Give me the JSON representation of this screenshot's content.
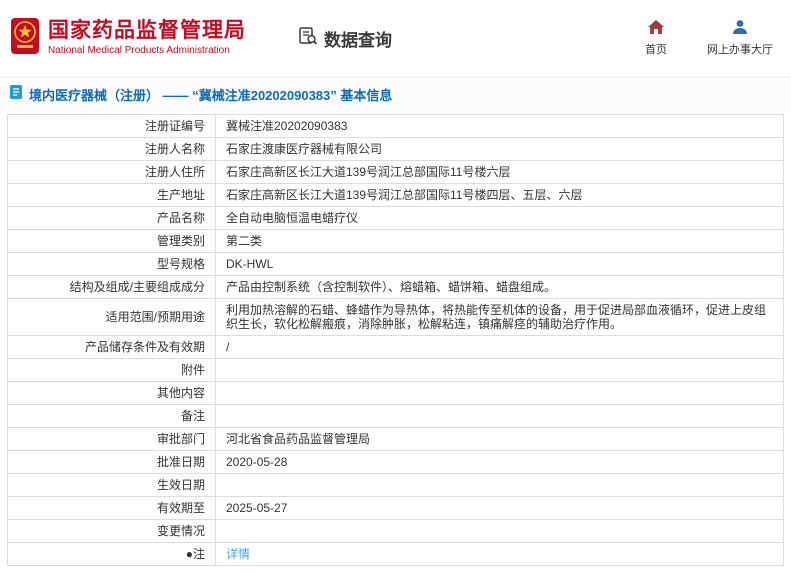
{
  "header": {
    "org_name_cn": "国家药品监督管理局",
    "org_name_en": "National Medical Products Administration",
    "section_title": "数据查询",
    "nav": [
      {
        "label": "首页"
      },
      {
        "label": "网上办事大厅"
      }
    ]
  },
  "breadcrumb": {
    "title": "境内医疗器械（注册） —— “冀械注准20202090383” 基本信息"
  },
  "table": {
    "rows": [
      {
        "label": "注册证编号",
        "value": "冀械注准20202090383"
      },
      {
        "label": "注册人名称",
        "value": "石家庄渡康医疗器械有限公司"
      },
      {
        "label": "注册人住所",
        "value": "石家庄高新区长江大道139号润江总部国际11号楼六层"
      },
      {
        "label": "生产地址",
        "value": "石家庄高新区长江大道139号润江总部国际11号楼四层、五层、六层"
      },
      {
        "label": "产品名称",
        "value": "全自动电脑恒温电蜡疗仪"
      },
      {
        "label": "管理类别",
        "value": "第二类"
      },
      {
        "label": "型号规格",
        "value": "DK-HWL"
      },
      {
        "label": "结构及组成/主要组成成分",
        "value": "产品由控制系统（含控制软件）、熔蜡箱、蜡饼箱、蜡盘组成。"
      },
      {
        "label": "适用范围/预期用途",
        "value": "利用加热溶解的石蜡、蜂蜡作为导热体，将热能传至机体的设备，用于促进局部血液循环，促进上皮组织生长，软化松解瘢痕，消除肿胀，松解粘连，镇痛解痉的辅助治疗作用。"
      },
      {
        "label": "产品储存条件及有效期",
        "value": "/"
      },
      {
        "label": "附件",
        "value": ""
      },
      {
        "label": "其他内容",
        "value": ""
      },
      {
        "label": "备注",
        "value": ""
      },
      {
        "label": "审批部门",
        "value": "河北省食品药品监督管理局"
      },
      {
        "label": "批准日期",
        "value": "2020-05-28"
      },
      {
        "label": "生效日期",
        "value": ""
      },
      {
        "label": "有效期至",
        "value": "2025-05-27"
      },
      {
        "label": "变更情况",
        "value": ""
      },
      {
        "label": "●注",
        "value": "详情",
        "link": true
      }
    ]
  },
  "icons": {
    "logo": "national-emblem",
    "query": "document-search",
    "home": "home",
    "service_hall": "person",
    "breadcrumb": "document"
  },
  "colors": {
    "brand_red": "#c30d23",
    "breadcrumb_blue": "#0f6bb6",
    "link_blue": "#4aa3df",
    "home_icon": "#a03c3c",
    "person_icon": "#2f6db5"
  }
}
